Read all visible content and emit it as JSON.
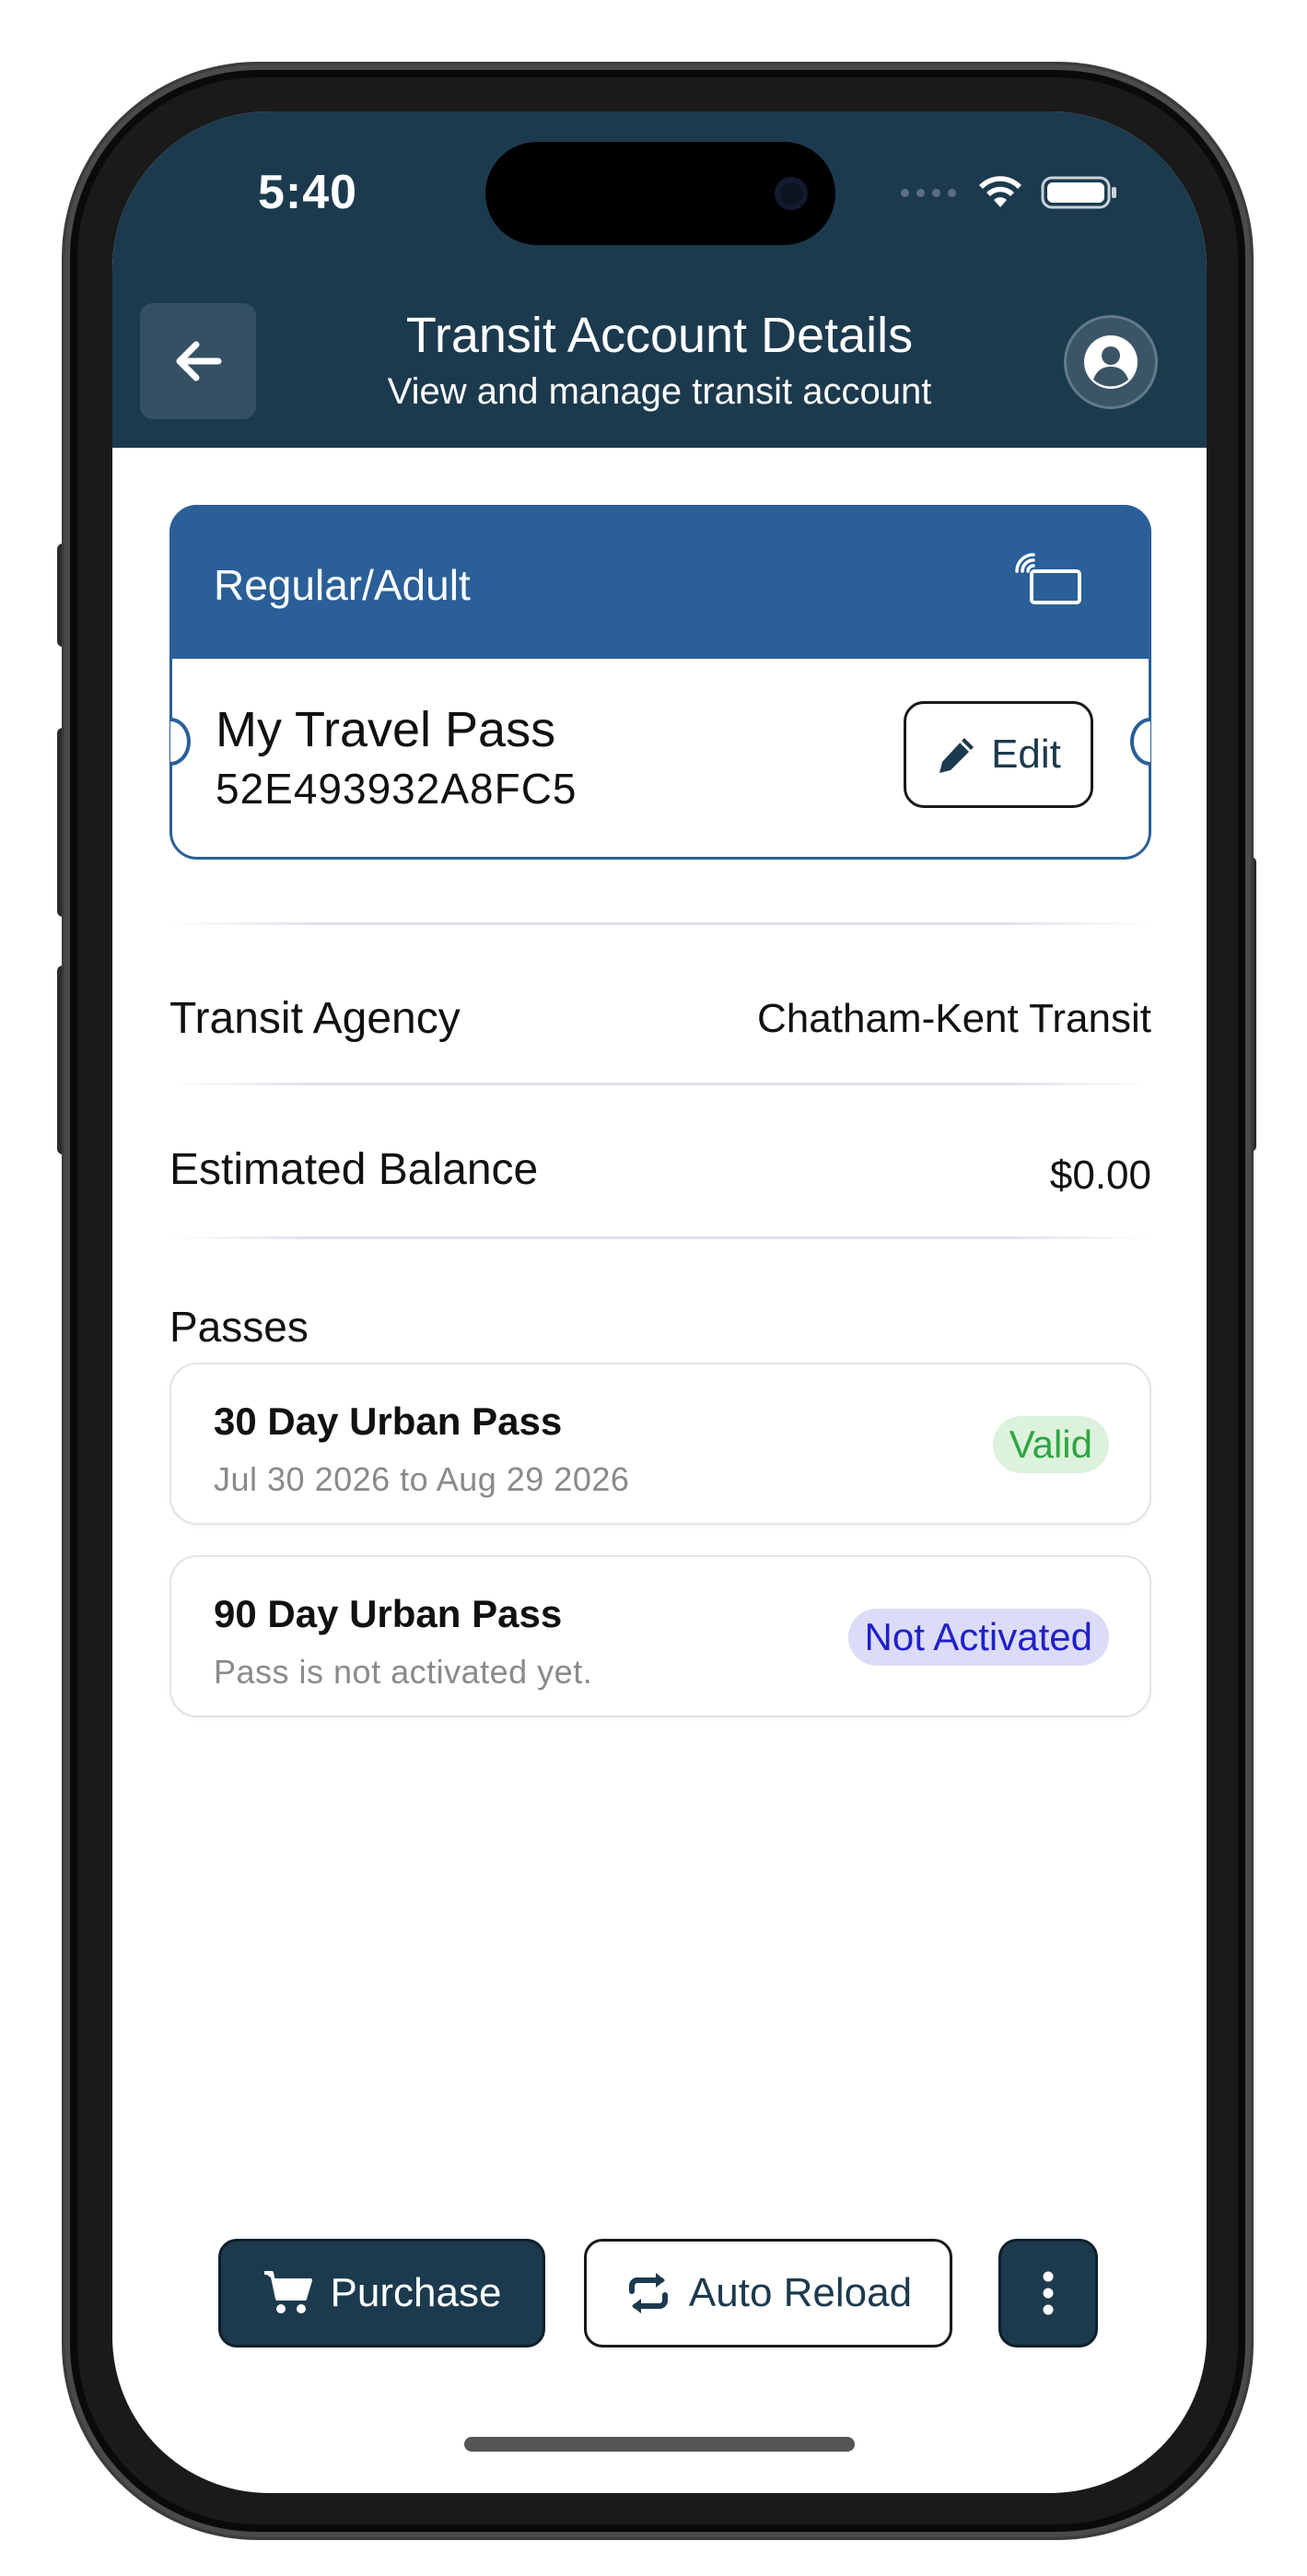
{
  "status_bar": {
    "time": "5:40"
  },
  "header": {
    "title": "Transit Account Details",
    "subtitle": "View and manage transit account"
  },
  "card": {
    "type": "Regular/Adult",
    "name": "My Travel Pass",
    "id": "52E493932A8FC5",
    "edit_label": "Edit",
    "colors": {
      "accent": "#2a5f98"
    }
  },
  "details": {
    "agency_label": "Transit Agency",
    "agency_value": "Chatham-Kent Transit",
    "balance_label": "Estimated Balance",
    "balance_value": "$0.00"
  },
  "passes": {
    "title": "Passes",
    "items": [
      {
        "name": "30 Day Urban Pass",
        "desc": "Jul 30 2026 to Aug 29 2026",
        "status": "Valid",
        "status_color": "#2fa542"
      },
      {
        "name": "90 Day Urban Pass",
        "desc": "Pass is not activated yet.",
        "status": "Not Activated",
        "status_color": "#2020c8"
      }
    ]
  },
  "actions": {
    "purchase_label": "Purchase",
    "auto_reload_label": "Auto Reload",
    "more_icon": "vertical-ellipsis-icon"
  },
  "theme": {
    "header_bg": "#1c3a4e",
    "card_blue": "#2a5f98"
  }
}
